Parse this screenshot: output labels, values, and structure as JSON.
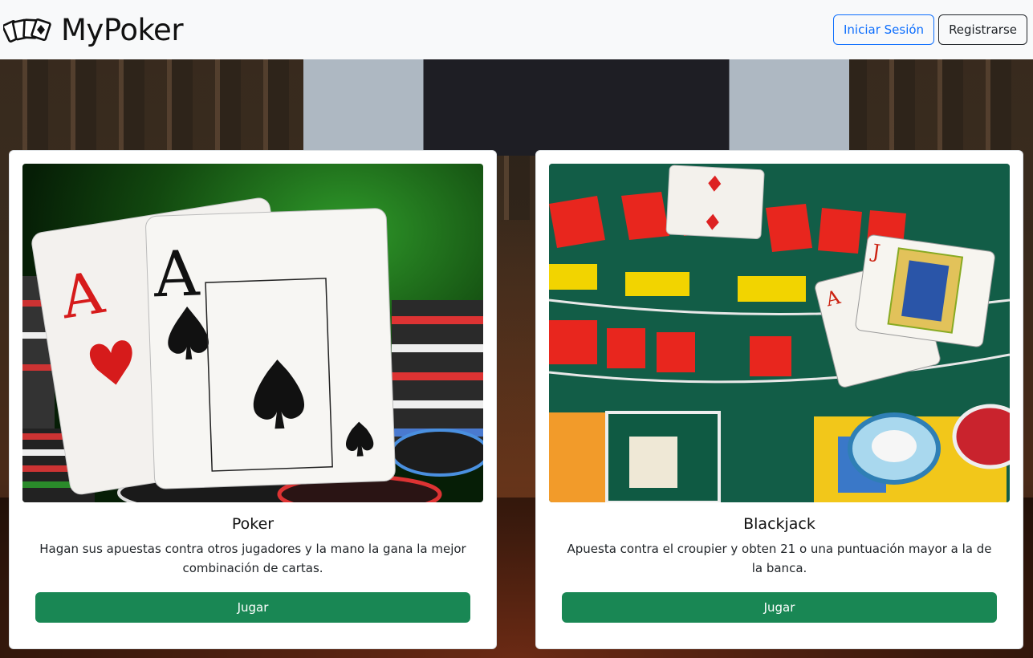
{
  "brand": {
    "name": "MyPoker",
    "logo_icon": "playing-cards-icon"
  },
  "nav": {
    "login_label": "Iniciar Sesión",
    "register_label": "Registrarse"
  },
  "games": [
    {
      "title": "Poker",
      "description": "Hagan sus apuestas contra otros jugadores y la mano la gana la mejor combinación de cartas.",
      "button_label": "Jugar",
      "image": "poker-aces-and-chips"
    },
    {
      "title": "Blackjack",
      "description": "Apuesta contra el croupier y obten 21 o una puntuación mayor a la de la banca.",
      "button_label": "Jugar",
      "image": "blackjack-table"
    }
  ],
  "colors": {
    "primary": "#0d6efd",
    "success": "#198754",
    "navbar_bg": "#f8f9fa"
  }
}
